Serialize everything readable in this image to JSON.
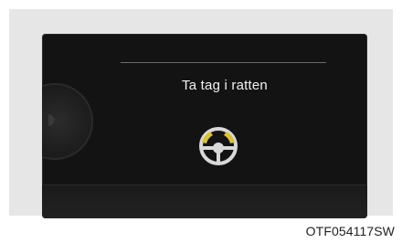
{
  "display": {
    "message": "Ta tag i ratten",
    "wheel_icon": "steering-wheel-hands-on-icon",
    "hand_grip_color": "#d8c23a"
  },
  "figure": {
    "code": "OTF054117SW"
  }
}
